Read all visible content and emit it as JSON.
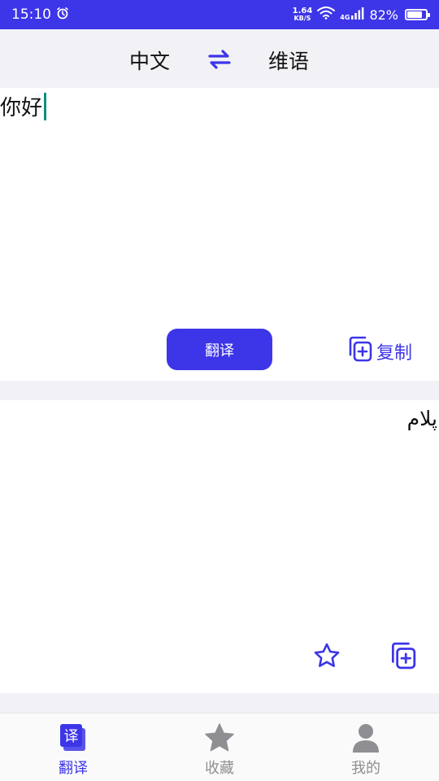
{
  "status_bar": {
    "time": "15:10",
    "net_speed_value": "1.64",
    "net_speed_unit": "KB/S",
    "network": "4G",
    "battery_text": "82%",
    "battery_level": 0.82
  },
  "language_bar": {
    "source_language": "中文",
    "target_language": "维语"
  },
  "input": {
    "text": "你好"
  },
  "actions": {
    "translate_label": "翻译",
    "copy_label": "复制"
  },
  "output": {
    "text": "پلام"
  },
  "bottom_nav": {
    "items": [
      {
        "label": "翻译",
        "icon": "translate-icon",
        "active": true,
        "icon_glyph": "译"
      },
      {
        "label": "收藏",
        "icon": "star-icon",
        "active": false
      },
      {
        "label": "我的",
        "icon": "person-icon",
        "active": false
      }
    ]
  },
  "colors": {
    "accent": "#3d35e8",
    "inactive": "#8e8e93",
    "caret": "#0d8f7b",
    "background": "#f2f2f6"
  }
}
